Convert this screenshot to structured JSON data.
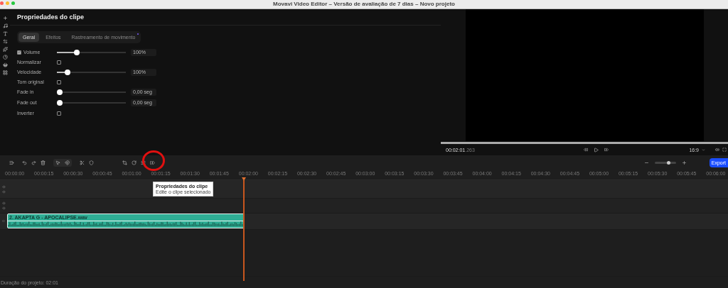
{
  "window": {
    "title": "Movavi Video Editor – Versão de avaliação de 7 dias – Novo projeto"
  },
  "panel": {
    "title": "Propriedades do clipe",
    "tabs": [
      {
        "label": "Geral",
        "selected": true,
        "badge": false
      },
      {
        "label": "Efeitos",
        "selected": false,
        "badge": false
      },
      {
        "label": "Rastreamento de movimento",
        "selected": false,
        "badge": true
      }
    ],
    "properties": [
      {
        "kind": "slider",
        "label": "Volume",
        "checked": true,
        "level": 0.27,
        "value": "100%"
      },
      {
        "kind": "checkbox",
        "label": "Normalizar",
        "checked": false
      },
      {
        "kind": "slider",
        "label": "Velocidade",
        "level": 0.12,
        "value": "100%"
      },
      {
        "kind": "checkbox",
        "label": "Tom original",
        "checked": false
      },
      {
        "kind": "slider",
        "label": "Fade in",
        "level": 0,
        "value": "0,00 seg"
      },
      {
        "kind": "slider",
        "label": "Fade out",
        "level": 0,
        "value": "0,00 seg"
      },
      {
        "kind": "checkbox",
        "label": "Inverter",
        "checked": false
      }
    ]
  },
  "preview": {
    "time": "00:02:01",
    "time_fraction": ".263",
    "aspect": "16:9",
    "level": 1
  },
  "toolbar": {
    "tooltip": {
      "title": "Propriedades do clipe",
      "subtitle": "Edite o clipe selecionado"
    },
    "zoom": {
      "level": 0.65
    },
    "export": "Export"
  },
  "ruler": {
    "labels": [
      "00:00:00",
      "00:00:15",
      "00:00:30",
      "00:00:45",
      "00:01:00",
      "00:01:15",
      "00:01:30",
      "00:01:45",
      "00:02:00",
      "00:02:15",
      "00:02:30",
      "00:02:45",
      "00:03:00",
      "00:03:15",
      "00:03:30",
      "00:03:45",
      "00:04:00",
      "00:04:15",
      "00:04:30",
      "00:04:45",
      "00:05:00",
      "00:05:15",
      "00:05:30",
      "00:05:45",
      "00:06:00"
    ]
  },
  "timeline": {
    "clip": {
      "name": "2. AKAPTA G - APOCALIPSE.wav",
      "selected": true
    }
  },
  "status_bar": "Duração do projeto: 02:01"
}
